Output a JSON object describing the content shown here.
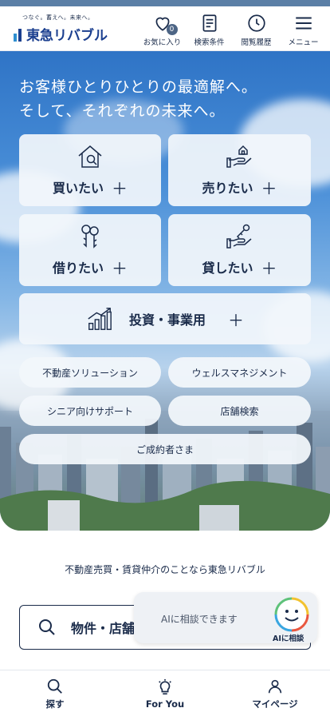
{
  "header": {
    "logo_tagline": "つなぐ。蓄えへ。未来へ。",
    "logo_name": "東急リバブル",
    "favorites_count": "0",
    "items": [
      {
        "label": "お気に入り",
        "icon": "heart-icon"
      },
      {
        "label": "検索条件",
        "icon": "document-icon"
      },
      {
        "label": "閲覧履歴",
        "icon": "clock-icon"
      },
      {
        "label": "メニュー",
        "icon": "hamburger-icon"
      }
    ]
  },
  "hero": {
    "headline_line1": "お客様ひとりひとりの最適解へ。",
    "headline_line2": "そして、それぞれの未来へ。",
    "tiles": [
      {
        "label": "買いたい",
        "icon": "house-search-icon"
      },
      {
        "label": "売りたい",
        "icon": "hand-house-icon"
      },
      {
        "label": "借りたい",
        "icon": "keys-icon"
      },
      {
        "label": "貸したい",
        "icon": "hand-key-icon"
      }
    ],
    "wide_tile": {
      "label": "投資・事業用",
      "icon": "bar-chart-growth-icon"
    },
    "plus_symbol": "＋",
    "pills": [
      {
        "label": "不動産ソリューション"
      },
      {
        "label": "ウェルスマネジメント"
      },
      {
        "label": "シニア向けサポート"
      },
      {
        "label": "店舗検索"
      }
    ],
    "contract_button": "ご成約者さま"
  },
  "tagline": "不動産売買・賃貸仲介のことなら東急リバブル",
  "search": {
    "label": "物件・店舗"
  },
  "ai_chat": {
    "prompt": "AIに相談できます",
    "caption": "AIに相談"
  },
  "bottom_nav": [
    {
      "label": "探す",
      "icon": "search-icon"
    },
    {
      "label": "For You",
      "icon": "lightbulb-icon"
    },
    {
      "label": "マイページ",
      "icon": "person-icon"
    }
  ],
  "colors": {
    "brand": "#1b3f8f",
    "text": "#1a2b4a",
    "sky": "#3a7fcf"
  }
}
